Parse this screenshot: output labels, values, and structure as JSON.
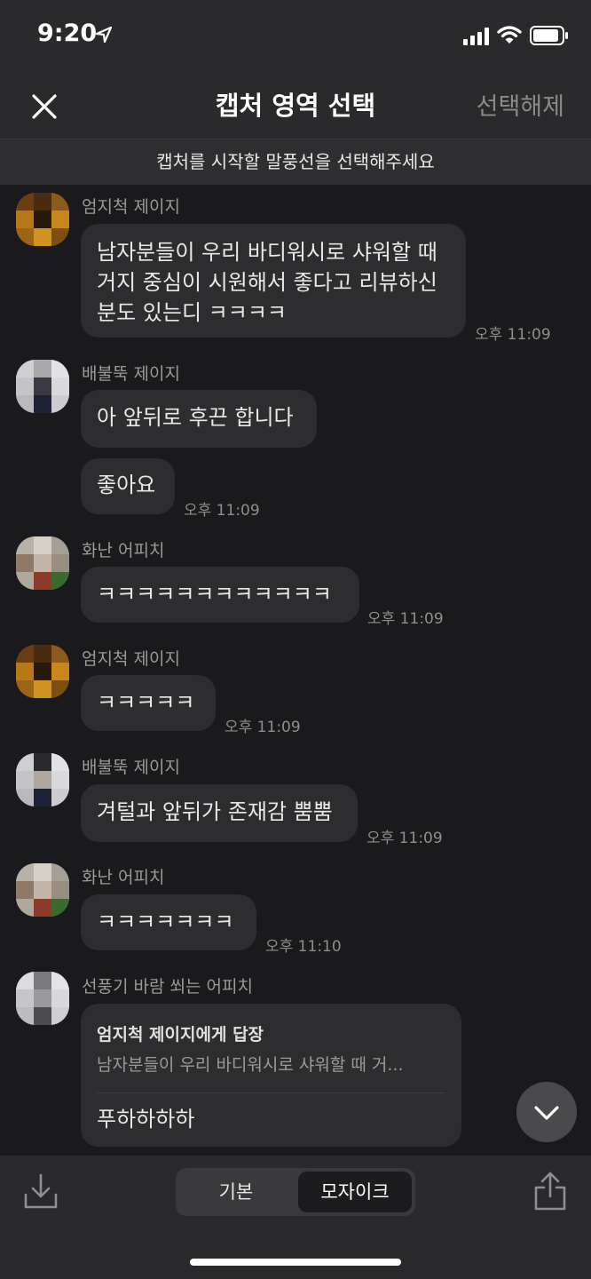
{
  "status": {
    "time": "9:20"
  },
  "nav": {
    "title": "캡처 영역 선택",
    "deselect": "선택해제"
  },
  "notice": "캡처를 시작할 말풍선을 선택해주세요",
  "messages": {
    "m1": {
      "sender": "엄지척 제이지",
      "lines": [
        "남자분들이 우리 바디워시로 샤워할 때",
        "거지 중심이 시원해서 좋다고 리뷰하신",
        "분도 있는디 ㅋㅋㅋㅋ"
      ],
      "time": "오후 11:09"
    },
    "m2": {
      "sender": "배불뚝 제이지",
      "text1": "아 앞뒤로 후끈 합니다",
      "text2": "좋아요",
      "time": "오후 11:09"
    },
    "m3": {
      "sender": "화난 어피치",
      "text": "ㅋㅋㅋㅋㅋㅋㅋㅋㅋㅋㅋㅋ",
      "time": "오후 11:09"
    },
    "m4": {
      "sender": "엄지척 제이지",
      "text": "ㅋㅋㅋㅋㅋ",
      "time": "오후 11:09"
    },
    "m5": {
      "sender": "배불뚝 제이지",
      "text": "겨털과 앞뒤가 존재감 뿜뿜",
      "time": "오후 11:09"
    },
    "m6": {
      "sender": "화난 어피치",
      "text": "ㅋㅋㅋㅋㅋㅋㅋ",
      "time": "오후 11:10"
    },
    "m7": {
      "sender": "선풍기 바람 쐬는 어피치",
      "reply_to": "엄지척 제이지에게 답장",
      "quote": "남자분들이 우리 바디워시로 샤워할 때 거...",
      "text": "푸하하하하"
    }
  },
  "toolbar": {
    "basic": "기본",
    "mosaic": "모자이크"
  },
  "icons": [
    "location-arrow-icon",
    "signal-icon",
    "wifi-icon",
    "battery-icon",
    "close-icon",
    "chevron-down-icon",
    "download-icon",
    "share-icon"
  ]
}
